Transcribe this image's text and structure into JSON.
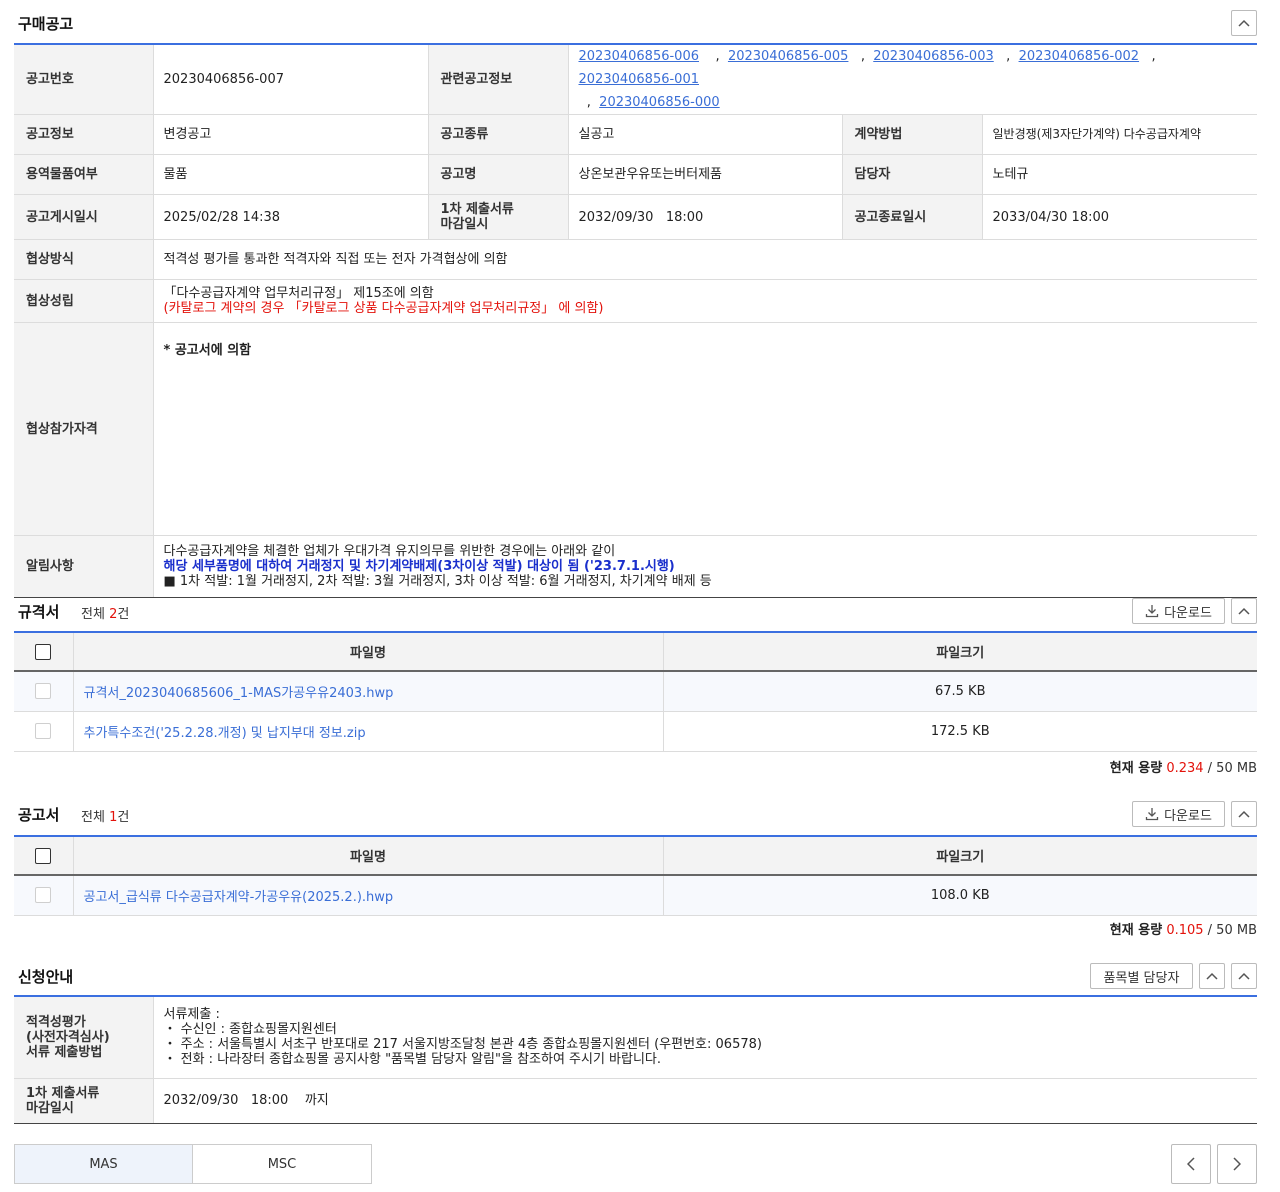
{
  "purchase": {
    "title": "구매공고",
    "rows": {
      "notice_no_label": "공고번호",
      "notice_no": "20230406856-007",
      "related_label": "관련공고정보",
      "related_links": [
        "20230406856-006",
        "20230406856-005",
        "20230406856-003",
        "20230406856-002",
        "20230406856-001",
        "20230406856-000"
      ],
      "sep": ",",
      "info_label": "공고정보",
      "info": "변경공고",
      "kind_label": "공고종류",
      "kind": "실공고",
      "contract_label": "계약방법",
      "contract": "일반경쟁(제3자단가계약) 다수공급자계약",
      "svc_label": "용역물품여부",
      "svc": "물품",
      "name_label": "공고명",
      "name": "상온보관우유또는버터제품",
      "manager_label": "담당자",
      "manager": "노테규",
      "posted_label": "공고게시일시",
      "posted": "2025/02/28 14:38",
      "deadline1_label_a": "1차 제출서류",
      "deadline1_label_b": "마감일시",
      "deadline1": "2032/09/30   18:00",
      "end_label": "공고종료일시",
      "end": "2033/04/30 18:00",
      "nego_method_label": "협상방식",
      "nego_method": "적격성 평가를 통과한 적격자와 직접 또는 전자 가격협상에 의함",
      "nego_est_label": "협상성립",
      "nego_est_1": "「다수공급자계약 업무처리규정」 제15조에 의함",
      "nego_est_2": "(카탈로그 계약의 경우 「카탈로그 상품 다수공급자계약 업무처리규정」 에 의함)",
      "qual_label": "협상참가자격",
      "qual": "* 공고서에 의함",
      "notice_label": "알림사항",
      "notice_1": "다수공급자계약을 체결한 업체가 우대가격 유지의무를 위반한 경우에는 아래와 같이",
      "notice_2": "해당 세부품명에 대하여 거래정지 및 차기계약배제(3차이상 적발) 대상이 됨 ('23.7.1.시행)",
      "notice_3": "■ 1차 적발: 1월 거래정지, 2차 적발: 3월 거래정지, 3차 이상 적발: 6월 거래정지, 차기계약 배제 등"
    }
  },
  "spec": {
    "title": "규격서",
    "count_prefix": "전체 ",
    "count": "2",
    "count_suffix": "건",
    "download": "다운로드",
    "col_name": "파일명",
    "col_size": "파일크기",
    "files": [
      {
        "name": "규격서_2023040685606_1-MAS가공우유2403.hwp",
        "size": "67.5 KB"
      },
      {
        "name": "추가특수조건('25.2.28.개정) 및 납지부대 정보.zip",
        "size": "172.5 KB"
      }
    ],
    "cap_label": "현재 용량",
    "cap_used": "0.234",
    "cap_total": " / 50 MB"
  },
  "notice_doc": {
    "title": "공고서",
    "count_prefix": "전체 ",
    "count": "1",
    "count_suffix": "건",
    "download": "다운로드",
    "col_name": "파일명",
    "col_size": "파일크기",
    "files": [
      {
        "name": "공고서_급식류 다수공급자계약-가공우유(2025.2.).hwp",
        "size": "108.0 KB"
      }
    ],
    "cap_label": "현재 용량",
    "cap_used": "0.105",
    "cap_total": " / 50 MB"
  },
  "apply": {
    "title": "신청안내",
    "item_manager_btn": "품목별 담당자",
    "method_label_1": "적격성평가",
    "method_label_2": "(사전자격심사)",
    "method_label_3": "서류 제출방법",
    "method_1": "서류제출 :",
    "method_2": "・ 수신인 : 종합쇼핑몰지원센터",
    "method_3": "・ 주소 : 서울특별시 서초구 반포대로 217 서울지방조달청 본관 4층 종합쇼핑몰지원센터 (우편번호: 06578)",
    "method_4": "・ 전화 : 나라장터 종합쇼핑몰 공지사항 \"품목별 담당자 알림\"을 참조하여 주시기 바랍니다.",
    "deadline_label_1": "1차 제출서류",
    "deadline_label_2": "마감일시",
    "deadline": "2032/09/30   18:00    까지"
  },
  "tabs": [
    "MAS",
    "MSC"
  ],
  "colors": {
    "accent": "#3b6fe0",
    "highlight": "#e3120b",
    "link": "#3a6ed6"
  }
}
